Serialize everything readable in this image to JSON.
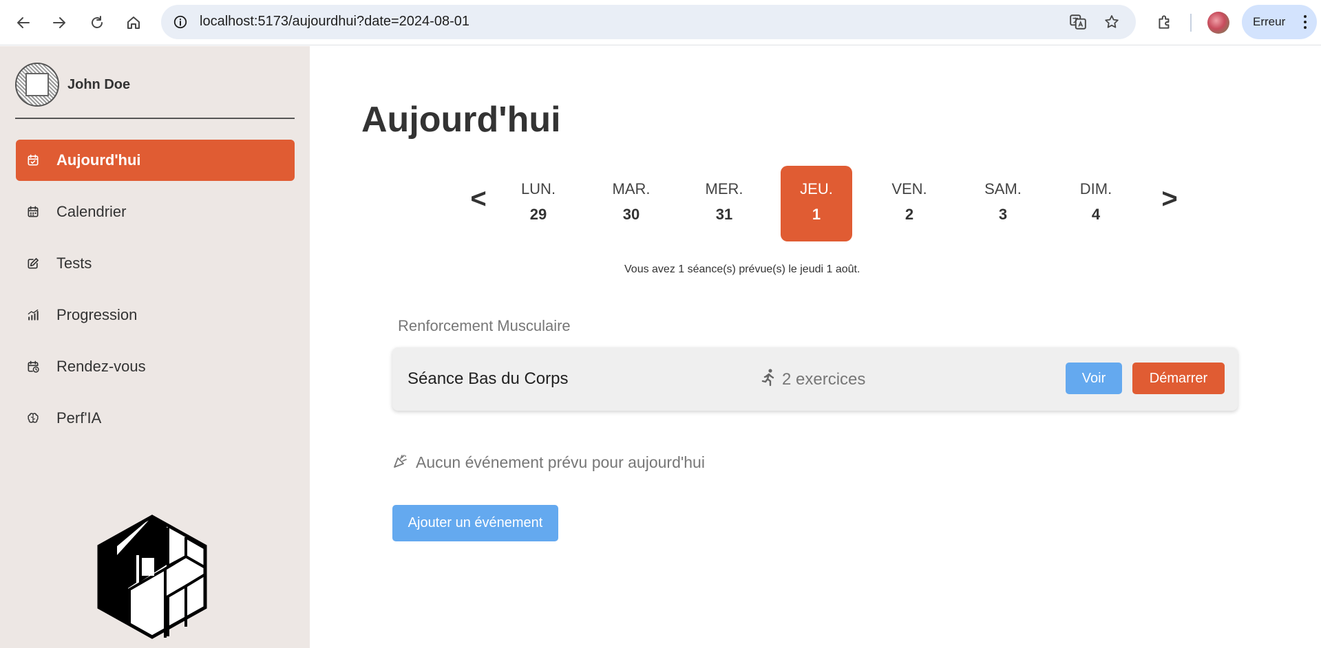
{
  "browser": {
    "url": "localhost:5173/aujourdhui?date=2024-08-01",
    "profile_status": "Erreur"
  },
  "sidebar": {
    "user_name": "John Doe",
    "items": [
      {
        "label": "Aujourd'hui",
        "icon": "calendar-check-icon",
        "active": true
      },
      {
        "label": "Calendrier",
        "icon": "calendar-icon",
        "active": false
      },
      {
        "label": "Tests",
        "icon": "edit-icon",
        "active": false
      },
      {
        "label": "Progression",
        "icon": "chart-icon",
        "active": false
      },
      {
        "label": "Rendez-vous",
        "icon": "calendar-clock-icon",
        "active": false
      },
      {
        "label": "Perf'IA",
        "icon": "brain-icon",
        "active": false
      }
    ]
  },
  "main": {
    "title": "Aujourd'hui",
    "week": {
      "prev": "<",
      "next": ">",
      "days": [
        {
          "name": "LUN.",
          "num": "29"
        },
        {
          "name": "MAR.",
          "num": "30"
        },
        {
          "name": "MER.",
          "num": "31"
        },
        {
          "name": "JEU.",
          "num": "1"
        },
        {
          "name": "VEN.",
          "num": "2"
        },
        {
          "name": "SAM.",
          "num": "3"
        },
        {
          "name": "DIM.",
          "num": "4"
        }
      ]
    },
    "summary": "Vous avez 1 séance(s) prévue(s) le jeudi 1 août.",
    "section_label": "Renforcement Musculaire",
    "session": {
      "title": "Séance Bas du Corps",
      "exercises": "2 exercices",
      "view_label": "Voir",
      "start_label": "Démarrer"
    },
    "no_event": "Aucun événement prévu pour aujourd'hui",
    "add_event_label": "Ajouter un événement"
  },
  "colors": {
    "accent": "#e05c33",
    "primary_blue": "#64a9ef",
    "sidebar_bg": "#ede7e4"
  }
}
